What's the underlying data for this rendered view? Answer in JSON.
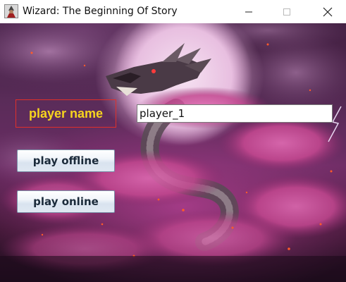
{
  "window": {
    "title": "Wizard: The Beginning Of Story",
    "icons": {
      "app": "wizard-app-icon",
      "minimize": "minimize-icon",
      "maximize": "maximize-icon",
      "close": "close-icon"
    }
  },
  "form": {
    "name_label": "player name",
    "name_value": "player_1",
    "offline_button": "play offline",
    "online_button": "play online"
  },
  "colors": {
    "label_text": "#f7d51e",
    "label_border": "#e0302a",
    "sky_glow": "#f1d4ec",
    "blossom": "#c2478f"
  }
}
